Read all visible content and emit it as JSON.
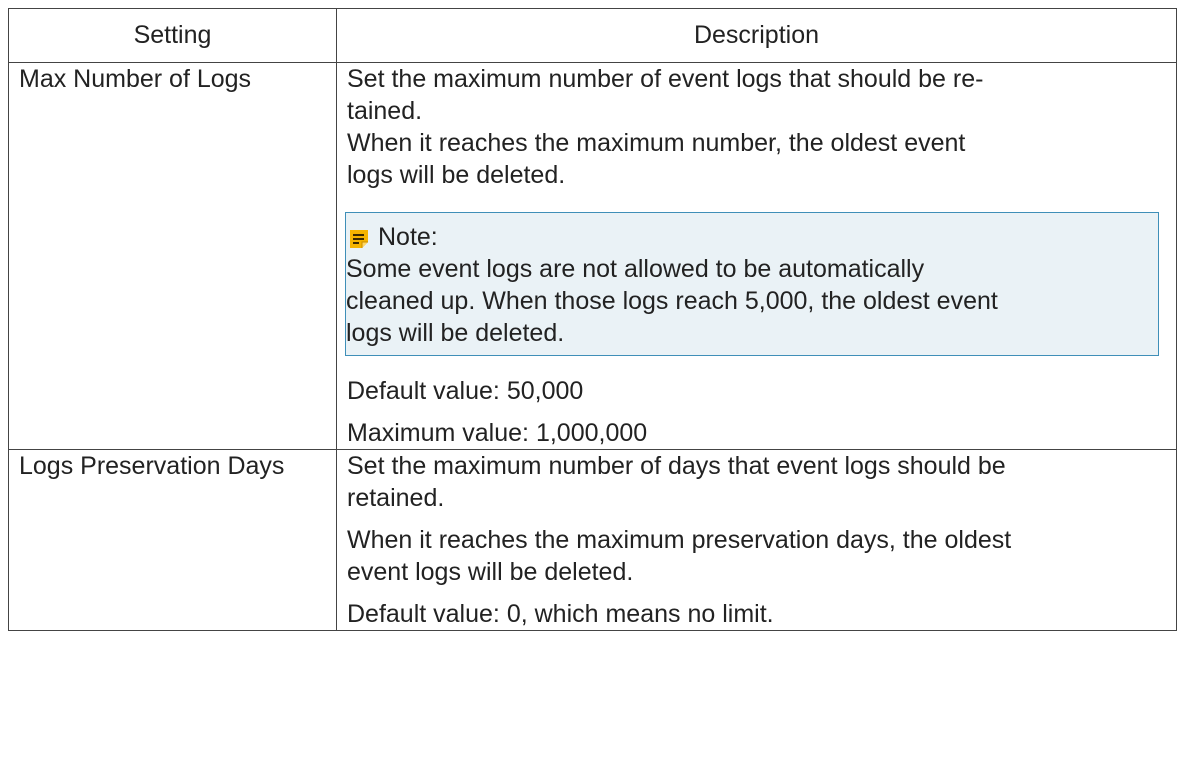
{
  "table": {
    "headers": {
      "setting": "Setting",
      "description": "Description"
    },
    "rows": [
      {
        "setting": "Max Number of Logs",
        "desc_line1": "Set the maximum number of event logs that should be re-",
        "desc_line2": "tained.",
        "desc_para2_line1": "When it reaches the maximum number, the oldest event",
        "desc_para2_line2": "logs will be deleted.",
        "note": {
          "icon": "note-icon",
          "title": "Note:",
          "body_line1": "Some event logs are not allowed to be automatically",
          "body_line2": "cleaned up. When those logs reach 5,000, the oldest event",
          "body_line3": "logs will be deleted."
        },
        "default_value": "Default value: 50,000",
        "maximum_value": "Maximum value: 1,000,000"
      },
      {
        "setting": "Logs Preservation Days",
        "desc_line1": "Set the maximum number of days that event logs should be",
        "desc_line2": "retained.",
        "desc_para2_line1": "When it reaches the maximum preservation days, the oldest",
        "desc_para2_line2": "event logs will be deleted.",
        "default_value": "Default value: 0, which means no limit."
      }
    ]
  },
  "colors": {
    "note_border": "#3f8fb8",
    "note_background": "#eaf2f6",
    "note_icon": "#f5b400",
    "text": "#222222",
    "table_border": "#444444"
  }
}
